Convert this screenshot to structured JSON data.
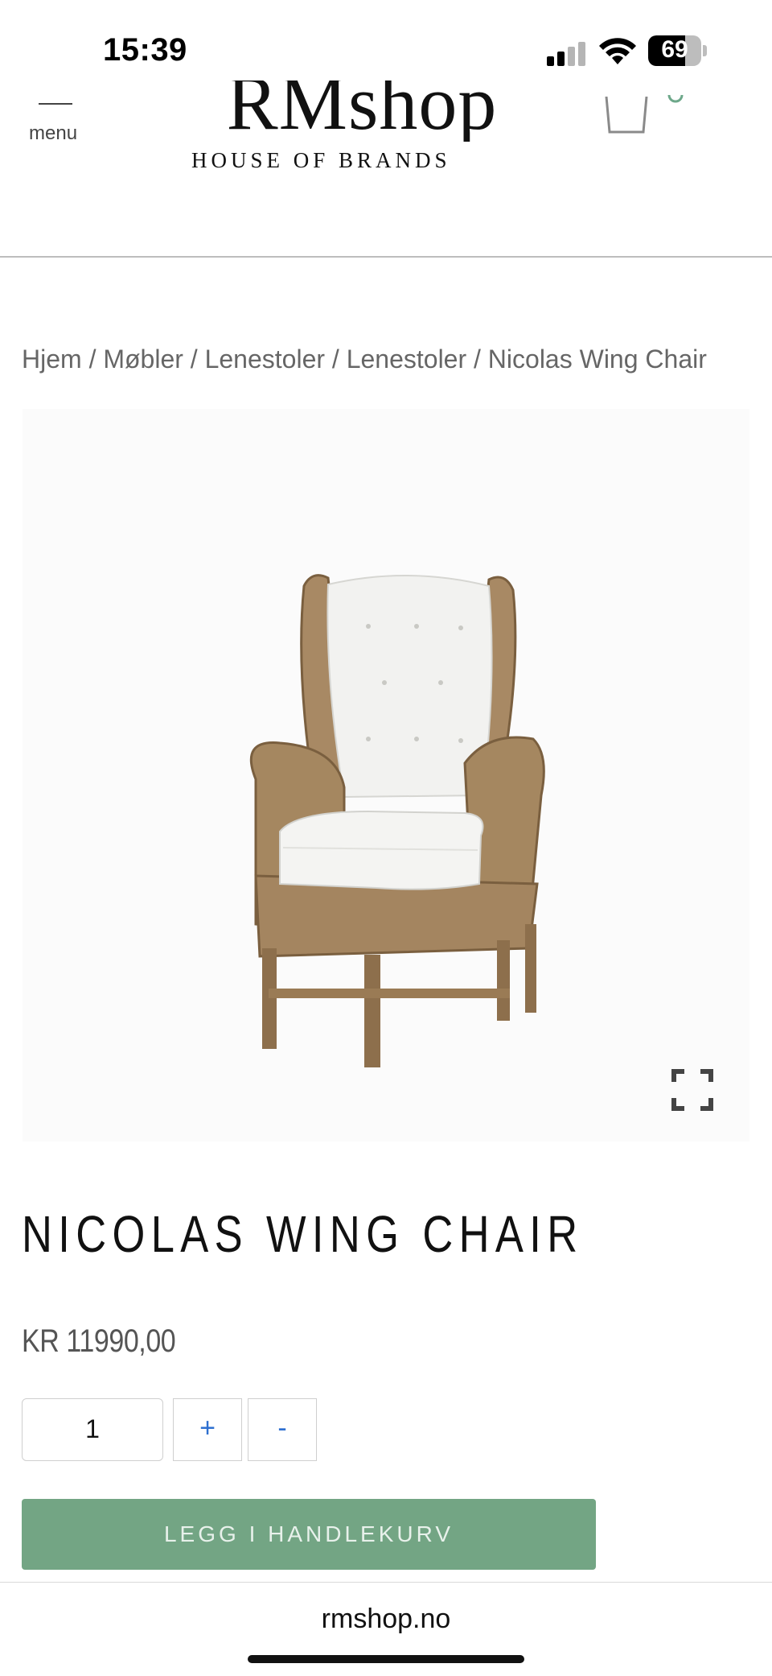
{
  "status_bar": {
    "time": "15:39",
    "battery_percent": 69
  },
  "header": {
    "menu_label": "menu",
    "logo_main": "RMshop",
    "logo_sub": "HOUSE OF BRANDS"
  },
  "breadcrumb": {
    "text": "Hjem / Møbler / Lenestoler / Lenestoler / Nicolas Wing Chair"
  },
  "product": {
    "title": "NICOLAS WING CHAIR",
    "price": "KR 11990,00",
    "quantity": "1",
    "plus_label": "+",
    "minus_label": "-",
    "add_to_cart_label": "LEGG I HANDLEKURV"
  },
  "browser": {
    "url": "rmshop.no"
  },
  "colors": {
    "accent_green": "#73a584",
    "qty_button_blue": "#2e6fd0",
    "divider": "#bdbdbd"
  },
  "icons": [
    "menu-icon",
    "cart-icon",
    "expand-icon",
    "signal-icon",
    "wifi-icon",
    "battery-icon"
  ]
}
